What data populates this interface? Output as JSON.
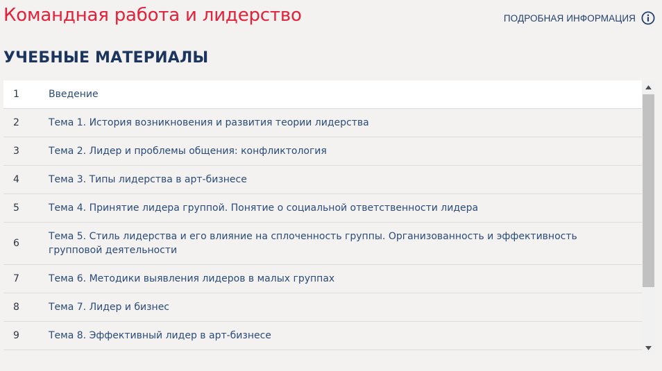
{
  "header": {
    "course_title": "Командная работа и лидерство",
    "details_label": "ПОДРОБНАЯ ИНФОРМАЦИЯ",
    "details_icon": "info-icon",
    "accent_color": "#e3213a",
    "brand_color": "#1c355e"
  },
  "materials": {
    "section_title": "УЧЕБНЫЕ МАТЕРИАЛЫ",
    "items": [
      {
        "num": "1",
        "title": "Введение"
      },
      {
        "num": "2",
        "title": "Тема 1. История возникновения и развития теории лидерства"
      },
      {
        "num": "3",
        "title": "Тема 2. Лидер и проблемы общения: конфликтология"
      },
      {
        "num": "4",
        "title": "Тема 3. Типы лидерства в арт-бизнесе"
      },
      {
        "num": "5",
        "title": "Тема 4. Принятие лидера группой. Понятие о социальной ответственности лидера"
      },
      {
        "num": "6",
        "title": "Тема 5. Стиль лидерства и его влияние на сплоченность группы. Организованность и эффективность групповой деятельности"
      },
      {
        "num": "7",
        "title": "Тема 6. Методики выявления лидеров в малых группах"
      },
      {
        "num": "8",
        "title": "Тема 7. Лидер и бизнес"
      },
      {
        "num": "9",
        "title": "Тема 8. Эффективный лидер в арт-бизнесе"
      }
    ]
  },
  "scrollbar": {
    "up_icon": "scroll-up-arrow-icon",
    "down_icon": "scroll-down-arrow-icon"
  }
}
